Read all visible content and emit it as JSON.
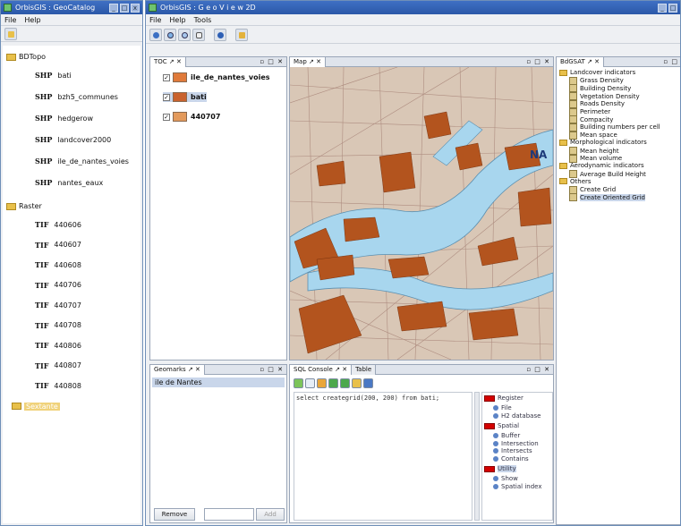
{
  "left_window": {
    "title": "OrbisGIS : GeoCatalog",
    "menu": [
      "File",
      "Help"
    ],
    "tree": {
      "groups": [
        {
          "label": "BDTopo",
          "items": [
            {
              "type": "SHP",
              "label": "bati"
            },
            {
              "type": "SHP",
              "label": "bzh5_communes"
            },
            {
              "type": "SHP",
              "label": "hedgerow"
            },
            {
              "type": "SHP",
              "label": "landcover2000"
            },
            {
              "type": "SHP",
              "label": "ile_de_nantes_voies"
            },
            {
              "type": "SHP",
              "label": "nantes_eaux"
            }
          ]
        },
        {
          "label": "Raster",
          "items": [
            {
              "type": "TIF",
              "label": "440606"
            },
            {
              "type": "TIF",
              "label": "440607"
            },
            {
              "type": "TIF",
              "label": "440608"
            },
            {
              "type": "TIF",
              "label": "440706"
            },
            {
              "type": "TIF",
              "label": "440707"
            },
            {
              "type": "TIF",
              "label": "440708"
            },
            {
              "type": "TIF",
              "label": "440806"
            },
            {
              "type": "TIF",
              "label": "440807"
            },
            {
              "type": "TIF",
              "label": "440808"
            }
          ]
        }
      ],
      "extra": "Sextante"
    }
  },
  "main_window": {
    "title": "OrbisGIS : G e o V i e w 2D",
    "menu": [
      "File",
      "Help",
      "Tools"
    ],
    "toc": {
      "tab": "TOC",
      "layers": [
        {
          "label": "ile_de_nantes_voies",
          "color": "#e07a3a"
        },
        {
          "label": "bati",
          "color": "#c9622e"
        },
        {
          "label": "440707",
          "color": "#e39a5c"
        }
      ]
    },
    "map": {
      "tab": "Map",
      "label": "NA"
    },
    "bdgeo": {
      "tab": "BdGSAT",
      "groups": [
        {
          "label": "Landcover indicators",
          "items": [
            "Grass Density",
            "Building Density",
            "Vegetation Density",
            "Roads Density",
            "Perimeter",
            "Compacity",
            "Building numbers per cell",
            "Mean space"
          ]
        },
        {
          "label": "Morphological indicators",
          "items": [
            "Mean height",
            "Mean volume"
          ]
        },
        {
          "label": "Aerodynamic indicators",
          "items": [
            "Average Build Height"
          ]
        },
        {
          "label": "Others",
          "items": [
            "Create Grid",
            "Create Oriented Grid"
          ]
        }
      ]
    },
    "geomarks": {
      "tab": "Geomarks",
      "items": [
        "ile de Nantes"
      ],
      "remove": "Remove",
      "add": "Add"
    },
    "sql": {
      "tab": "SQL Console",
      "tab2": "Table",
      "query": "select creategrid(200, 200) from bati;",
      "functions": [
        {
          "group": "Register",
          "items": [
            "File",
            "H2 database"
          ]
        },
        {
          "group": "Spatial",
          "items": [
            "Buffer",
            "Intersection",
            "Intersects",
            "Contains"
          ]
        },
        {
          "group": "Utility",
          "items": [
            "Show",
            "Spatial index"
          ]
        }
      ]
    }
  },
  "colors": {
    "titlebar": "#2b58a8",
    "building": "#b3541e",
    "water": "#a8d6ee"
  }
}
